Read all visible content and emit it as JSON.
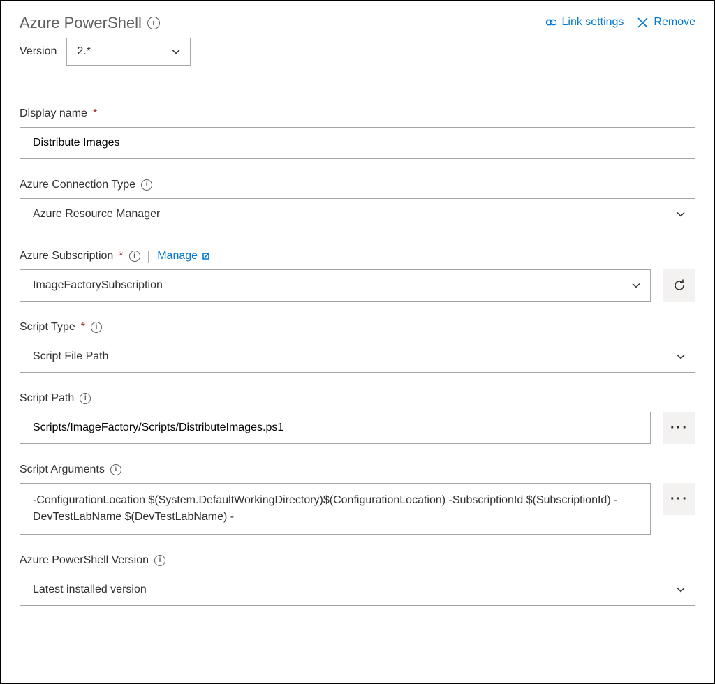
{
  "header": {
    "title": "Azure PowerShell",
    "link_settings": "Link settings",
    "remove": "Remove"
  },
  "version": {
    "label": "Version",
    "value": "2.*"
  },
  "display_name": {
    "label": "Display name",
    "value": "Distribute Images"
  },
  "connection_type": {
    "label": "Azure Connection Type",
    "value": "Azure Resource Manager"
  },
  "subscription": {
    "label": "Azure Subscription",
    "manage": "Manage",
    "value": "ImageFactorySubscription"
  },
  "script_type": {
    "label": "Script Type",
    "value": "Script File Path"
  },
  "script_path": {
    "label": "Script Path",
    "value": "Scripts/ImageFactory/Scripts/DistributeImages.ps1"
  },
  "script_args": {
    "label": "Script Arguments",
    "value": " -ConfigurationLocation $(System.DefaultWorkingDirectory)$(ConfigurationLocation) -SubscriptionId $(SubscriptionId) -DevTestLabName $(DevTestLabName) -"
  },
  "ps_version": {
    "label": "Azure PowerShell Version",
    "value": "Latest installed version"
  }
}
